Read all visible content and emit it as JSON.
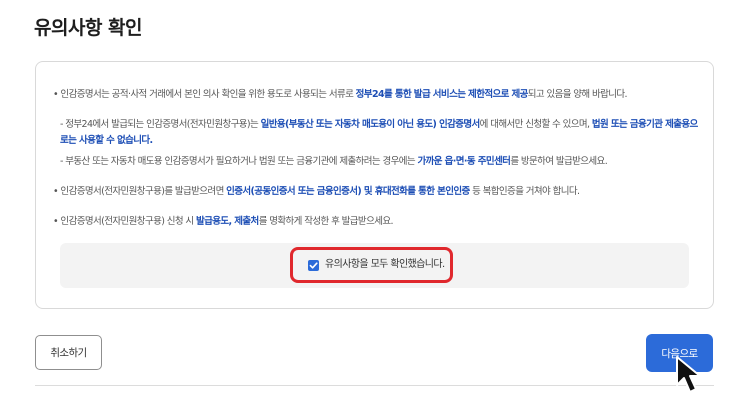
{
  "page_title": "유의사항 확인",
  "notices": {
    "n1": {
      "a": "• 인감증명서는 공적·사적 거래에서 본인 의사 확인을 위한 용도로 사용되는 서류로 ",
      "b": "정부24를 통한 발급 서비스는 제한적으로 제공",
      "c": "되고 있음을 양해 바랍니다."
    },
    "n2": {
      "a": "- 정부24에서 발급되는 인감증명서(전자민원창구용)는 ",
      "b": "일반용(부동산 또는 자동차 매도용이 아닌 용도) 인감증명서",
      "c": "에 대해서만 신청할 수 있으며, ",
      "d": "법원 또는 금융기관 제출용으로는 사용할 수 없습니다."
    },
    "n3": {
      "a": "- 부동산 또는 자동차 매도용 인감증명서가 필요하거나 법원 또는 금융기관에 제출하려는 경우에는 ",
      "b": "가까운 읍·면·동 주민센터",
      "c": "를 방문하여 발급받으세요."
    },
    "n4": {
      "a": "• 인감증명서(전자민원창구용)를 발급받으려면 ",
      "b": "인증서(공동인증서 또는 금융인증서) 및 휴대전화를 통한 본인인증",
      "c": " 등 복합인증을 거쳐야 합니다."
    },
    "n5": {
      "a": "• 인감증명서(전자민원창구용) 신청 시 ",
      "b": "발급용도, 제출처",
      "c": "를 명확하게 작성한 후 발급받으세요."
    }
  },
  "confirm": {
    "label": "유의사항을 모두 확인했습니다.",
    "checked": true
  },
  "buttons": {
    "cancel": "취소하기",
    "next": "다음으로"
  },
  "colors": {
    "accent": "#2c6bd9",
    "emphasis": "#1d4eb5",
    "highlight_border": "#e0282d"
  }
}
